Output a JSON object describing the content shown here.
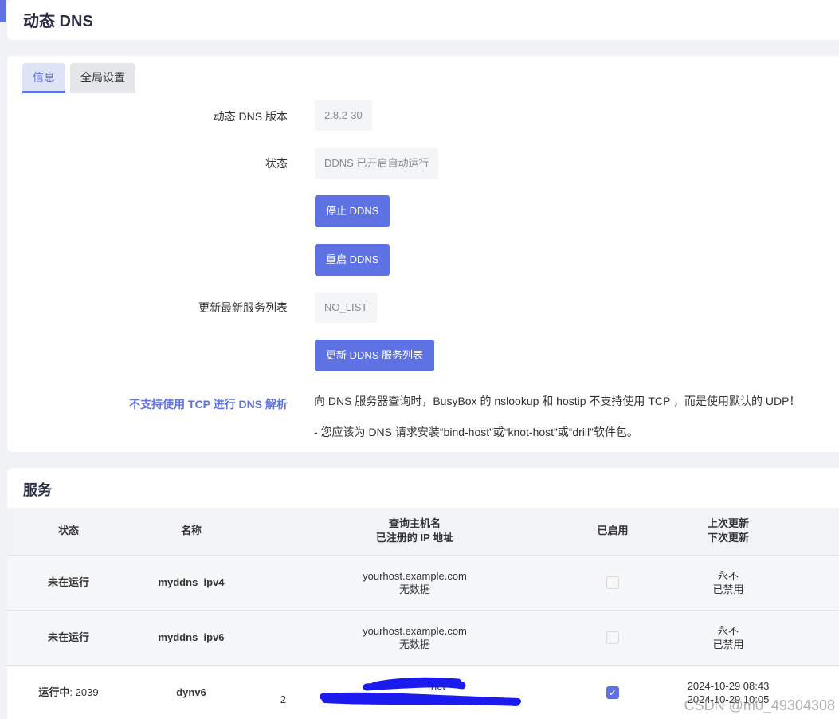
{
  "page": {
    "title": "动态 DNS"
  },
  "tabs": [
    {
      "label": "信息"
    },
    {
      "label": "全局设置"
    }
  ],
  "info": {
    "version_label": "动态 DNS 版本",
    "version_value": "2.8.2-30",
    "status_label": "状态",
    "status_value": "DDNS 已开启自动运行",
    "stop_button": "停止 DDNS",
    "restart_button": "重启 DDNS",
    "service_list_label": "更新最新服务列表",
    "service_list_value": "NO_LIST",
    "update_list_button": "更新 DDNS 服务列表",
    "tcp_label": "不支持使用 TCP 进行 DNS 解析",
    "tcp_note_1": "向 DNS 服务器查询时，BusyBox 的 nslookup 和 hostip 不支持使用 TCP ，而是使用默认的 UDP！",
    "tcp_note_2": "- 您应该为 DNS 请求安装“bind-host”或“knot-host”或“drill”软件包。"
  },
  "services": {
    "title": "服务",
    "columns": {
      "status": "状态",
      "name": "名称",
      "host_1": "查询主机名",
      "host_2": "已注册的 IP 地址",
      "enabled": "已启用",
      "update_1": "上次更新",
      "update_2": "下次更新"
    },
    "rows": [
      {
        "status": "未在运行",
        "name": "myddns_ipv4",
        "host": "yourhost.example.com",
        "ip": "无数据",
        "enabled": false,
        "last": "永不",
        "next": "已禁用"
      },
      {
        "status": "未在运行",
        "name": "myddns_ipv6",
        "host": "yourhost.example.com",
        "ip": "无数据",
        "enabled": false,
        "last": "永不",
        "next": "已禁用"
      },
      {
        "status": "运行中",
        "pid": ": 2039",
        "name": "dynv6",
        "host": "net",
        "ip": "2",
        "enabled": true,
        "last": "2024-10-29 08:43",
        "next": "2024-10-29 10:05"
      }
    ]
  },
  "watermark": "CSDN @m0_49304308",
  "colors": {
    "accent": "#5e72e4",
    "scribble": "#1b1bf0"
  }
}
